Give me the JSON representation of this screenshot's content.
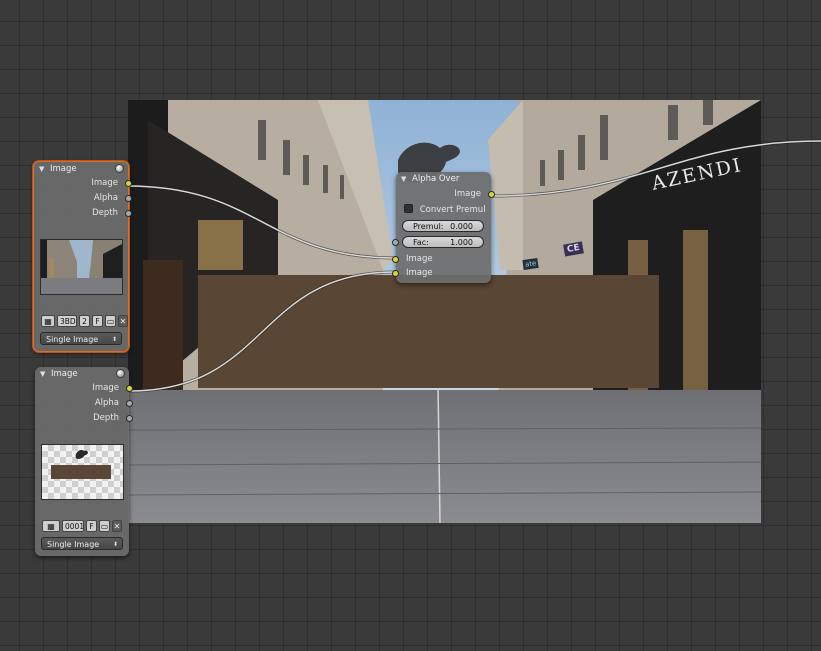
{
  "backdrop": {
    "shop_sign_main": "AZENDI",
    "shop_sign_purple": "CE",
    "shop_sign_small": "ate"
  },
  "image_node_1": {
    "title": "Image",
    "outputs": [
      "Image",
      "Alpha",
      "Depth"
    ],
    "image_name": "3BD",
    "users": "2",
    "fake_user": "F",
    "source": "Single Image"
  },
  "image_node_2": {
    "title": "Image",
    "outputs": [
      "Image",
      "Alpha",
      "Depth"
    ],
    "image_name": "0001",
    "fake_user": "F",
    "source": "Single Image"
  },
  "alpha_over_node": {
    "title": "Alpha Over",
    "output": "Image",
    "convert_premul_label": "Convert Premul",
    "premul_label": "Premul:",
    "premul_value": "0.000",
    "fac_label": "Fac:",
    "fac_value": "1.000",
    "inputs": [
      "Image",
      "Image"
    ]
  },
  "colors": {
    "socket_color": "#d8d33a",
    "socket_value": "#a8a8a8",
    "selected_outline": "#e06d1f",
    "overlay_brown": "#5a4634"
  }
}
